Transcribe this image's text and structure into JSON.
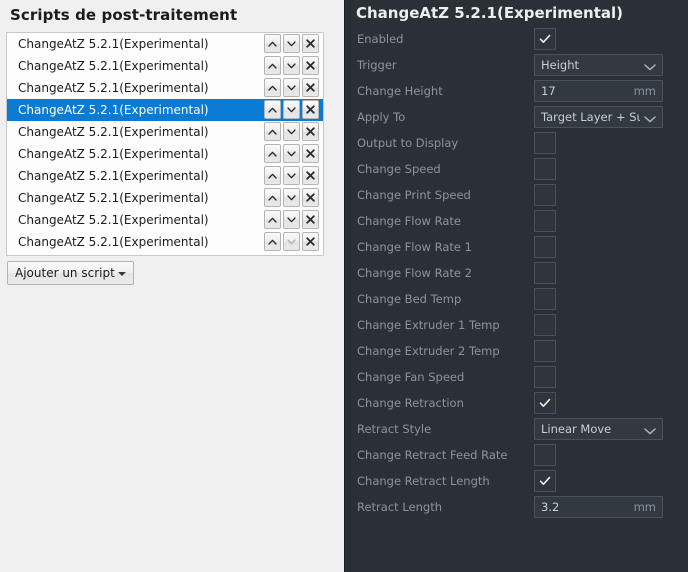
{
  "colors": {
    "light_panel_bg": "#f0f0f0",
    "list_bg": "#fdfdfd",
    "selection_blue": "#0a7bd4",
    "dark_panel_bg": "#2b3036",
    "field_bg": "#333940",
    "label_gray": "#8b949c",
    "value_gray": "#c7ced4"
  },
  "left": {
    "title": "Scripts de post-traitement",
    "add_button": {
      "label": "Ajouter un script",
      "caret_icon": "caret-down-icon"
    },
    "row_buttons": {
      "up_icon": "chevron-up-icon",
      "down_icon": "chevron-down-icon",
      "remove_icon": "close-x-icon"
    },
    "scripts": [
      {
        "label": "ChangeAtZ 5.2.1(Experimental)",
        "selected": false,
        "down_disabled": false
      },
      {
        "label": "ChangeAtZ 5.2.1(Experimental)",
        "selected": false,
        "down_disabled": false
      },
      {
        "label": "ChangeAtZ 5.2.1(Experimental)",
        "selected": false,
        "down_disabled": false
      },
      {
        "label": "ChangeAtZ 5.2.1(Experimental)",
        "selected": true,
        "down_disabled": false
      },
      {
        "label": "ChangeAtZ 5.2.1(Experimental)",
        "selected": false,
        "down_disabled": false
      },
      {
        "label": "ChangeAtZ 5.2.1(Experimental)",
        "selected": false,
        "down_disabled": false
      },
      {
        "label": "ChangeAtZ 5.2.1(Experimental)",
        "selected": false,
        "down_disabled": false
      },
      {
        "label": "ChangeAtZ 5.2.1(Experimental)",
        "selected": false,
        "down_disabled": false
      },
      {
        "label": "ChangeAtZ 5.2.1(Experimental)",
        "selected": false,
        "down_disabled": false
      },
      {
        "label": "ChangeAtZ 5.2.1(Experimental)",
        "selected": false,
        "down_disabled": true
      }
    ]
  },
  "right": {
    "title": "ChangeAtZ 5.2.1(Experimental)",
    "settings": [
      {
        "label": "Enabled",
        "type": "checkbox",
        "checked": true
      },
      {
        "label": "Trigger",
        "type": "dropdown",
        "value": "Height"
      },
      {
        "label": "Change Height",
        "type": "text",
        "value": "17",
        "unit": "mm"
      },
      {
        "label": "Apply To",
        "type": "dropdown",
        "value": "Target Layer + Su..."
      },
      {
        "label": "Output to Display",
        "type": "checkbox",
        "checked": false
      },
      {
        "label": "Change Speed",
        "type": "checkbox",
        "checked": false
      },
      {
        "label": "Change Print Speed",
        "type": "checkbox",
        "checked": false
      },
      {
        "label": "Change Flow Rate",
        "type": "checkbox",
        "checked": false
      },
      {
        "label": "Change Flow Rate 1",
        "type": "checkbox",
        "checked": false
      },
      {
        "label": "Change Flow Rate 2",
        "type": "checkbox",
        "checked": false
      },
      {
        "label": "Change Bed Temp",
        "type": "checkbox",
        "checked": false
      },
      {
        "label": "Change Extruder 1 Temp",
        "type": "checkbox",
        "checked": false
      },
      {
        "label": "Change Extruder 2 Temp",
        "type": "checkbox",
        "checked": false
      },
      {
        "label": "Change Fan Speed",
        "type": "checkbox",
        "checked": false
      },
      {
        "label": "Change Retraction",
        "type": "checkbox",
        "checked": true
      },
      {
        "label": "Retract Style",
        "type": "dropdown",
        "value": "Linear Move"
      },
      {
        "label": "Change Retract Feed Rate",
        "type": "checkbox",
        "checked": false
      },
      {
        "label": "Change Retract Length",
        "type": "checkbox",
        "checked": true
      },
      {
        "label": "Retract Length",
        "type": "text",
        "value": "3.2",
        "unit": "mm"
      }
    ]
  }
}
